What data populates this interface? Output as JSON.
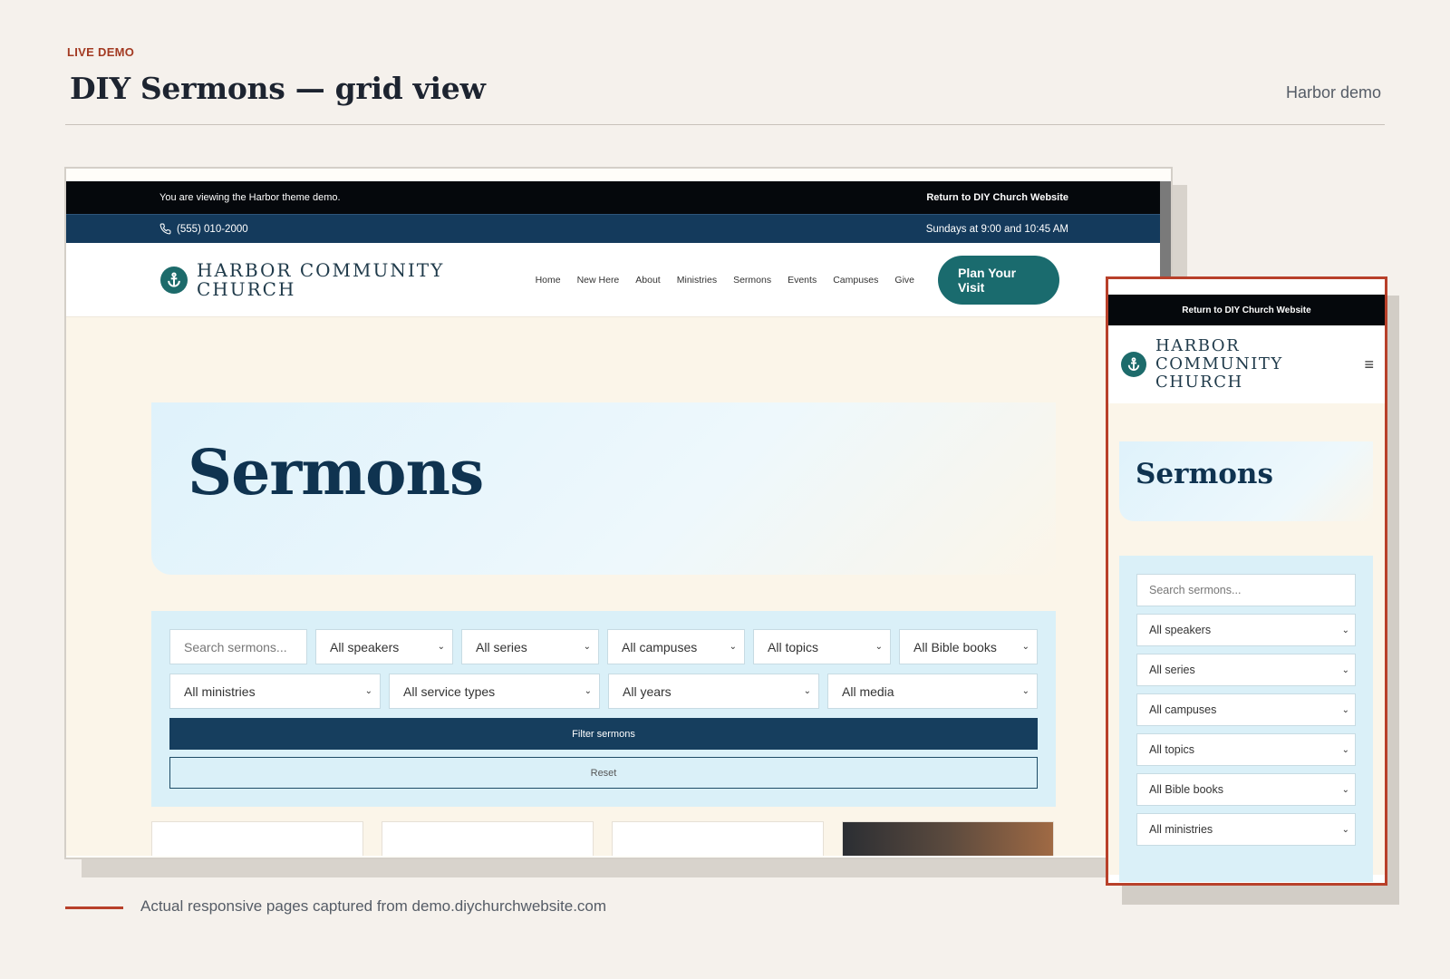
{
  "page": {
    "eyebrow": "LIVE DEMO",
    "title": "DIY Sermons — grid view",
    "tag": "Harbor demo",
    "caption": "Actual responsive pages captured from demo.diychurchwebsite.com"
  },
  "desktop": {
    "topbar": {
      "notice": "You are viewing the Harbor theme demo.",
      "return_link": "Return to DIY Church Website"
    },
    "infobar": {
      "phone": "(555) 010-2000",
      "service_times": "Sundays at 9:00 and 10:45 AM"
    },
    "header": {
      "logo_line1": "HARBOR COMMUNITY",
      "logo_line2": "CHURCH",
      "nav": [
        "Home",
        "New Here",
        "About",
        "Ministries",
        "Sermons",
        "Events",
        "Campuses",
        "Give"
      ],
      "cta_line1": "Plan Your",
      "cta_line2": "Visit"
    },
    "hero_title": "Sermons",
    "filters": {
      "search_placeholder": "Search sermons...",
      "row1": [
        "All speakers",
        "All series",
        "All campuses",
        "All topics",
        "All Bible books"
      ],
      "row2": [
        "All ministries",
        "All service types",
        "All years",
        "All media"
      ],
      "filter_button": "Filter sermons",
      "reset_button": "Reset"
    }
  },
  "mobile": {
    "return_link": "Return to DIY Church Website",
    "logo_line1": "HARBOR",
    "logo_line2": "COMMUNITY",
    "logo_line3": "CHURCH",
    "hero_title": "Sermons",
    "search_placeholder": "Search sermons...",
    "selects": [
      "All speakers",
      "All series",
      "All campuses",
      "All topics",
      "All Bible books",
      "All ministries"
    ]
  },
  "colors": {
    "accent": "#b8402a",
    "navy": "#143a5c",
    "teal": "#1a6b6e",
    "filter_bg": "#daf0f8"
  },
  "icons": {
    "phone": "phone-icon",
    "anchor": "anchor-icon",
    "menu": "hamburger-menu-icon",
    "select": "chevron-down-icon"
  }
}
